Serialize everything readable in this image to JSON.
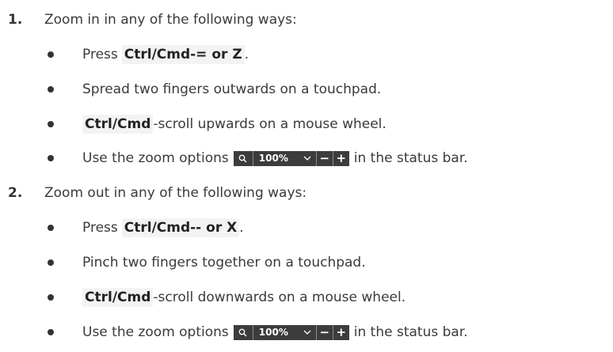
{
  "steps": [
    {
      "number": "1.",
      "text": "Zoom in in any of the following ways:",
      "bullets": [
        {
          "pre": "Press",
          "key": "Ctrl/Cmd-= or Z",
          "post": "."
        },
        {
          "text": "Spread two fingers outwards on a touchpad."
        },
        {
          "key": "Ctrl/Cmd",
          "post": "-scroll upwards on a mouse wheel."
        },
        {
          "pre": "Use the zoom options",
          "post": "in the status bar."
        }
      ]
    },
    {
      "number": "2.",
      "text": "Zoom out in any of the following ways:",
      "bullets": [
        {
          "pre": "Press",
          "key": "Ctrl/Cmd-- or X",
          "post": "."
        },
        {
          "text": "Pinch two fingers together on a touchpad."
        },
        {
          "key": "Ctrl/Cmd",
          "post": "-scroll downwards on a mouse wheel."
        },
        {
          "pre": "Use the zoom options",
          "post": "in the status bar."
        }
      ]
    }
  ],
  "zoom_widget": {
    "search_icon": "magnifier-icon",
    "value": "100%",
    "dropdown_icon": "chevron-down-icon",
    "minus_label": "−",
    "plus_label": "+",
    "background": "#3c3c3c",
    "text_color": "#ffffff"
  },
  "colors": {
    "text": "#3a3a3a",
    "key_background": "#f3f3f3"
  }
}
